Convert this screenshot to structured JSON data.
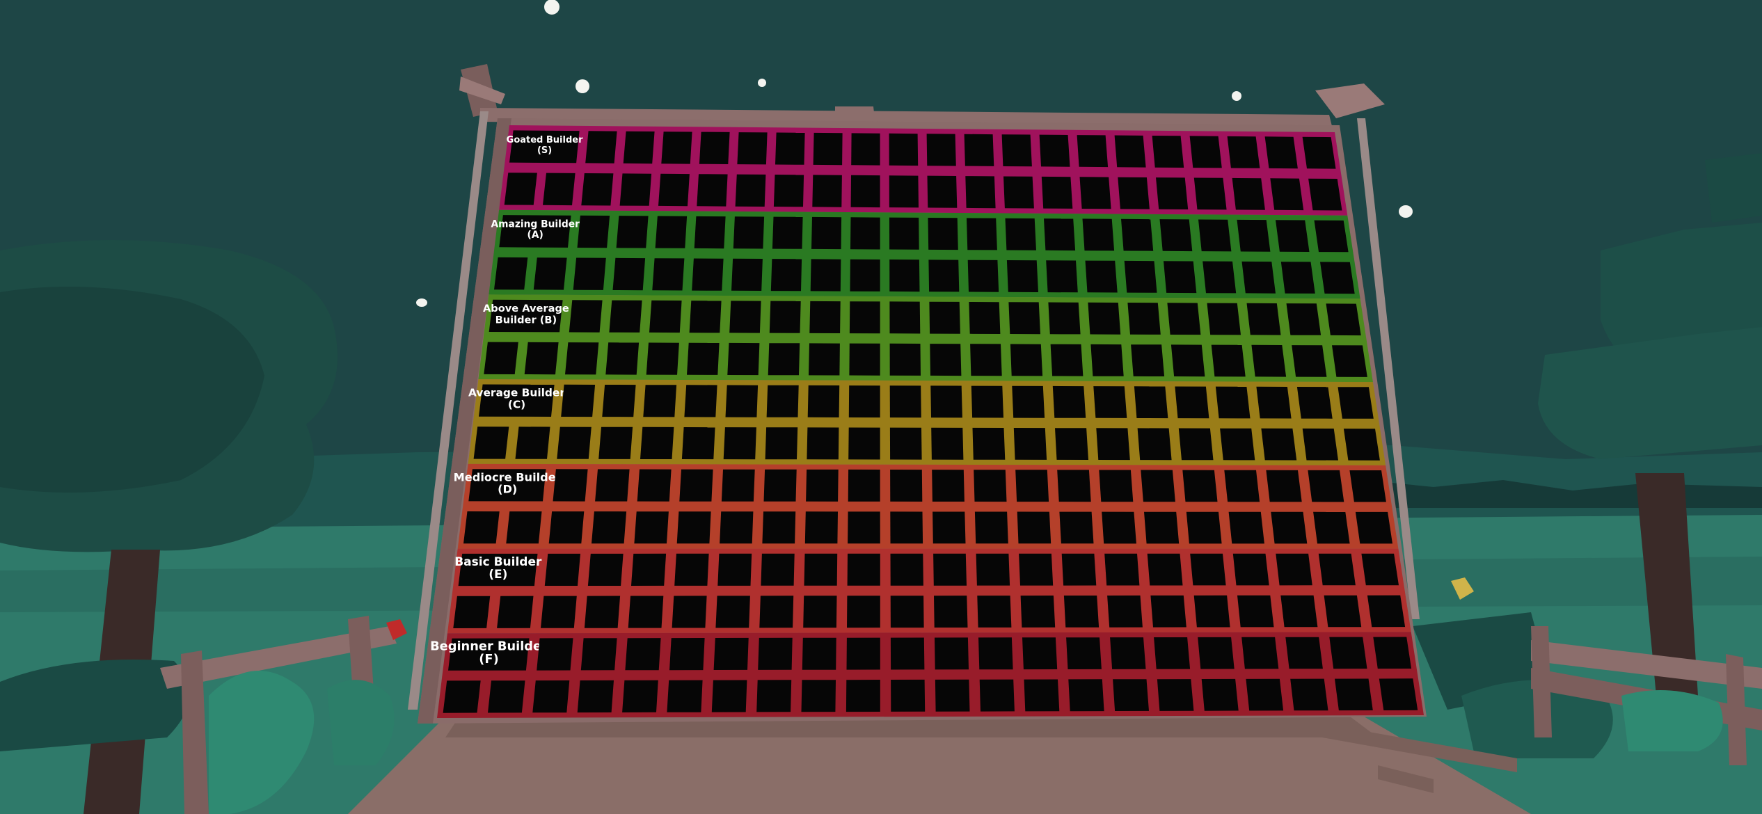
{
  "colors": {
    "sky": "#1e4646",
    "ground": "#2f7a6a",
    "path": "#8a6e68",
    "frame": "#8c6e6c",
    "cell": "#060606"
  },
  "board": {
    "columns": 22,
    "tiers": [
      {
        "id": "S",
        "title_line1": "Goated Builder",
        "title_line2": "(S)",
        "sub": "",
        "color": "#a0125c",
        "rows": 2
      },
      {
        "id": "A",
        "title_line1": "Amazing Builder",
        "title_line2": "(A)",
        "sub": "",
        "color": "#2a7a22",
        "rows": 2
      },
      {
        "id": "B",
        "title_line1": "Above Average",
        "title_line2": "Builder (B)",
        "sub": "",
        "color": "#4e8a1e",
        "rows": 2
      },
      {
        "id": "C",
        "title_line1": "Average Builder",
        "title_line2": "(C)",
        "sub": "",
        "color": "#9a7d18",
        "rows": 2
      },
      {
        "id": "D",
        "title_line1": "Mediocre Builder",
        "title_line2": "(D)",
        "sub": "",
        "color": "#b5402a",
        "rows": 2
      },
      {
        "id": "E",
        "title_line1": "Basic Builder",
        "title_line2": "(E)",
        "sub": "",
        "color": "#b0302e",
        "rows": 2
      },
      {
        "id": "F",
        "title_line1": "Beginner Builder",
        "title_line2": "(F)",
        "sub": "",
        "color": "#981c2a",
        "rows": 2
      }
    ]
  }
}
